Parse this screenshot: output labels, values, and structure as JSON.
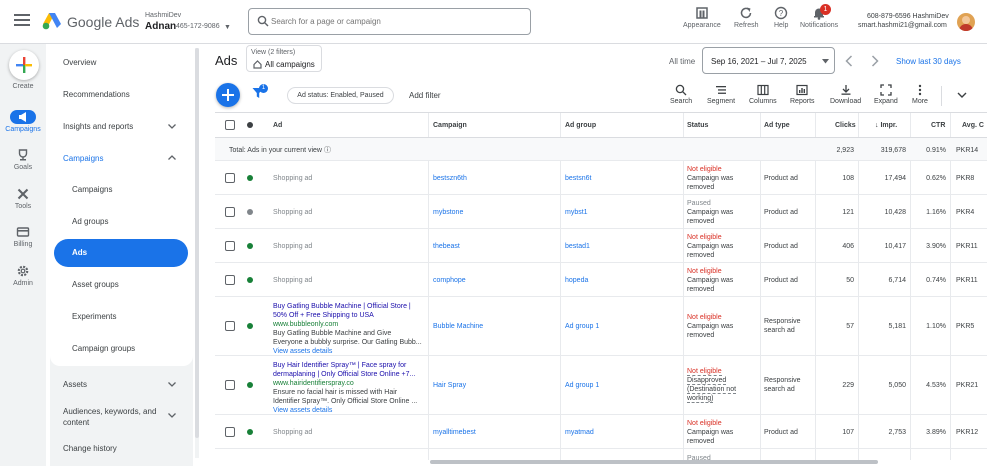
{
  "app": {
    "brand": "Google Ads",
    "account_label": "HashmiDev",
    "account_name": "Adnan",
    "account_id": "465-172-9086",
    "search_placeholder": "Search for a page or campaign"
  },
  "top_tools": [
    {
      "label": "Appearance",
      "icon": "appearance-icon"
    },
    {
      "label": "Refresh",
      "icon": "refresh-icon"
    },
    {
      "label": "Help",
      "icon": "help-icon"
    },
    {
      "label": "Notifications",
      "icon": "bell-icon",
      "badge": "1"
    }
  ],
  "user": {
    "phone": "608-879-6596 HashmiDev",
    "email": "smart.hashmi21@gmail.com"
  },
  "rail": [
    {
      "label": "Create"
    },
    {
      "label": "Campaigns"
    },
    {
      "label": "Goals"
    },
    {
      "label": "Tools"
    },
    {
      "label": "Billing"
    },
    {
      "label": "Admin"
    }
  ],
  "nav": {
    "overview": "Overview",
    "recommendations": "Recommendations",
    "insights": "Insights and reports",
    "campaigns_section": "Campaigns",
    "sub": [
      "Campaigns",
      "Ad groups",
      "Ads",
      "Asset groups",
      "Experiments",
      "Campaign groups"
    ],
    "assets": "Assets",
    "audiences": "Audiences, keywords, and content",
    "change_history": "Change history"
  },
  "page": {
    "title": "Ads",
    "view_filters": "View (2 filters)",
    "view_name": "All campaigns",
    "all_time": "All time",
    "date_range": "Sep 16, 2021 – Jul 7, 2025",
    "show_last": "Show last 30 days"
  },
  "toolbar": {
    "filter_badge": "1",
    "chip": "Ad status: Enabled, Paused",
    "add_filter": "Add filter",
    "tools": [
      "Search",
      "Segment",
      "Columns",
      "Reports",
      "Download",
      "Expand",
      "More"
    ]
  },
  "table": {
    "headers": {
      "ad": "Ad",
      "campaign": "Campaign",
      "adgroup": "Ad group",
      "status": "Status",
      "adtype": "Ad type",
      "clicks": "Clicks",
      "impr": "Impr.",
      "ctr": "CTR",
      "avg": "Avg. C"
    },
    "total": {
      "label": "Total: Ads in your current view",
      "clicks": "2,923",
      "impr": "319,678",
      "ctr": "0.91%",
      "avg": "PKR14"
    },
    "rows": [
      {
        "ad": "Shopping ad",
        "campaign": "bestszn6th",
        "adgroup": "bestsn6t",
        "status1": "Not eligible",
        "status2": "Campaign was",
        "status3": "removed",
        "adtype": "Product ad",
        "clicks": "108",
        "impr": "17,494",
        "ctr": "0.62%",
        "avg": "PKR8"
      },
      {
        "ad": "Shopping ad",
        "campaign": "mybstone",
        "adgroup": "mybst1",
        "status1": "Paused",
        "status2": "Campaign was",
        "status3": "removed",
        "adtype": "Product ad",
        "clicks": "121",
        "impr": "10,428",
        "ctr": "1.16%",
        "avg": "PKR4"
      },
      {
        "ad": "Shopping ad",
        "campaign": "thebeast",
        "adgroup": "bestad1",
        "status1": "Not eligible",
        "status2": "Campaign was",
        "status3": "removed",
        "adtype": "Product ad",
        "clicks": "406",
        "impr": "10,417",
        "ctr": "3.90%",
        "avg": "PKR11"
      },
      {
        "ad": "Shopping ad",
        "campaign": "comphope",
        "adgroup": "hopeda",
        "status1": "Not eligible",
        "status2": "Campaign was",
        "status3": "removed",
        "adtype": "Product ad",
        "clicks": "50",
        "impr": "6,714",
        "ctr": "0.74%",
        "avg": "PKR11"
      },
      {
        "ad_title1": "Buy Gatling Bubble Machine | Official Store |",
        "ad_title2": "50% Off + Free Shipping to USA",
        "ad_url": "www.bubbleonly.com",
        "ad_desc1": "Buy Gatling Bubble Machine and Give",
        "ad_desc2": "Everyone a bubbly surprise. Our Gatling Bubb...",
        "ad_assets": "View assets details",
        "campaign": "Bubble Machine",
        "adgroup": "Ad group 1",
        "status1": "Not eligible",
        "status2": "Campaign was",
        "status3": "removed",
        "adtype1": "Responsive",
        "adtype2": "search ad",
        "clicks": "57",
        "impr": "5,181",
        "ctr": "1.10%",
        "avg": "PKR5"
      },
      {
        "ad_title1": "Buy Hair Identifier Spray™ | Face spray for",
        "ad_title2": "dermaplaning | Only Official Store Online  +7...",
        "ad_url": "www.hairidentifierspray.co",
        "ad_desc1": "Ensure no facial hair is missed with Hair",
        "ad_desc2": "Identifier Spray™. Only Official Store Online ...",
        "ad_assets": "View assets details",
        "campaign": "Hair Spray",
        "adgroup": "Ad group 1",
        "status1": "Not eligible",
        "status2": "Disapproved",
        "status3": "(Destination not",
        "status4": "working)",
        "adtype1": "Responsive",
        "adtype2": "search ad",
        "clicks": "229",
        "impr": "5,050",
        "ctr": "4.53%",
        "avg": "PKR21"
      },
      {
        "ad": "Shopping ad",
        "campaign": "myalltimebest",
        "adgroup": "myatmad",
        "status1": "Not eligible",
        "status2": "Campaign was",
        "status3": "removed",
        "adtype": "Product ad",
        "clicks": "107",
        "impr": "2,753",
        "ctr": "3.89%",
        "avg": "PKR12"
      },
      {
        "status1": "Paused"
      }
    ]
  }
}
